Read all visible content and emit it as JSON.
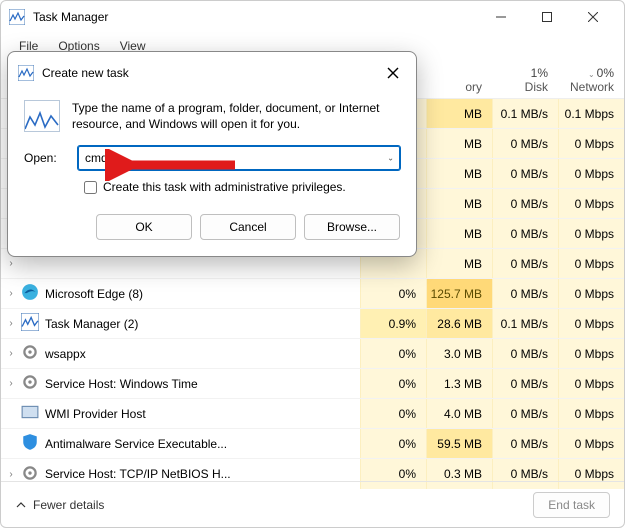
{
  "window": {
    "title": "Task Manager"
  },
  "menu": {
    "file": "File",
    "options": "Options",
    "view": "View"
  },
  "headers": {
    "cpu": {
      "label": "ory"
    },
    "disk": {
      "pct": "1%",
      "label": "Disk"
    },
    "net": {
      "pct": "0%",
      "label": "Network"
    }
  },
  "rows": [
    {
      "name": "",
      "cpu": "",
      "mem": "MB",
      "disk": "0.1 MB/s",
      "net": "0.1 Mbps",
      "memclass": "med"
    },
    {
      "name": "",
      "cpu": "",
      "mem": "MB",
      "disk": "0 MB/s",
      "net": "0 Mbps",
      "memclass": ""
    },
    {
      "name": "",
      "cpu": "",
      "mem": "MB",
      "disk": "0 MB/s",
      "net": "0 Mbps",
      "memclass": ""
    },
    {
      "name": "",
      "cpu": "",
      "mem": "MB",
      "disk": "0 MB/s",
      "net": "0 Mbps",
      "memclass": ""
    },
    {
      "name": "",
      "cpu": "",
      "mem": "MB",
      "disk": "0 MB/s",
      "net": "0 Mbps",
      "memclass": ""
    },
    {
      "name": "",
      "cpu": "",
      "mem": "MB",
      "disk": "0 MB/s",
      "net": "0 Mbps",
      "memclass": ""
    },
    {
      "name": "Microsoft Edge (8)",
      "cpu": "0%",
      "mem": "125.7 MB",
      "disk": "0 MB/s",
      "net": "0 Mbps",
      "memclass": "high",
      "icon": "edge"
    },
    {
      "name": "Task Manager (2)",
      "cpu": "0.9%",
      "mem": "28.6 MB",
      "disk": "0.1 MB/s",
      "net": "0 Mbps",
      "memclass": "med",
      "cpuclass": "active",
      "icon": "tm"
    },
    {
      "name": "wsappx",
      "cpu": "0%",
      "mem": "3.0 MB",
      "disk": "0 MB/s",
      "net": "0 Mbps",
      "memclass": "",
      "icon": "gear"
    },
    {
      "name": "Service Host: Windows Time",
      "cpu": "0%",
      "mem": "1.3 MB",
      "disk": "0 MB/s",
      "net": "0 Mbps",
      "memclass": "",
      "icon": "gear"
    },
    {
      "name": "WMI Provider Host",
      "cpu": "0%",
      "mem": "4.0 MB",
      "disk": "0 MB/s",
      "net": "0 Mbps",
      "memclass": "",
      "icon": "wmi",
      "noexpand": true
    },
    {
      "name": "Antimalware Service Executable...",
      "cpu": "0%",
      "mem": "59.5 MB",
      "disk": "0 MB/s",
      "net": "0 Mbps",
      "memclass": "med",
      "icon": "shield",
      "noexpand": true
    },
    {
      "name": "Service Host: TCP/IP NetBIOS H...",
      "cpu": "0%",
      "mem": "0.3 MB",
      "disk": "0 MB/s",
      "net": "0 Mbps",
      "memclass": "",
      "icon": "gear"
    }
  ],
  "footer": {
    "fewer": "Fewer details",
    "endtask": "End task"
  },
  "dialog": {
    "title": "Create new task",
    "desc": "Type the name of a program, folder, document, or Internet resource, and Windows will open it for you.",
    "open_label": "Open:",
    "value": "cmd",
    "admin": "Create this task with administrative privileges.",
    "ok": "OK",
    "cancel": "Cancel",
    "browse": "Browse..."
  }
}
